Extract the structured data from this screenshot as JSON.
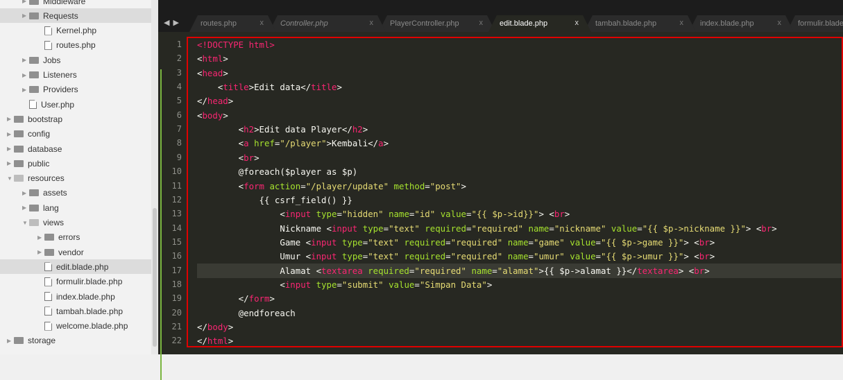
{
  "sidebar": {
    "rows": [
      {
        "label": "Middleware",
        "type": "folder",
        "depth": 2,
        "open": false
      },
      {
        "label": "Requests",
        "type": "folder",
        "depth": 2,
        "open": false,
        "selected": true
      },
      {
        "label": "Kernel.php",
        "type": "file",
        "depth": 3
      },
      {
        "label": "routes.php",
        "type": "file",
        "depth": 3
      },
      {
        "label": "Jobs",
        "type": "folder",
        "depth": 2,
        "open": false
      },
      {
        "label": "Listeners",
        "type": "folder",
        "depth": 2,
        "open": false
      },
      {
        "label": "Providers",
        "type": "folder",
        "depth": 2,
        "open": false
      },
      {
        "label": "User.php",
        "type": "file",
        "depth": 2
      },
      {
        "label": "bootstrap",
        "type": "folder",
        "depth": 1,
        "open": false
      },
      {
        "label": "config",
        "type": "folder",
        "depth": 1,
        "open": false
      },
      {
        "label": "database",
        "type": "folder",
        "depth": 1,
        "open": false
      },
      {
        "label": "public",
        "type": "folder",
        "depth": 1,
        "open": false
      },
      {
        "label": "resources",
        "type": "folder",
        "depth": 1,
        "open": true
      },
      {
        "label": "assets",
        "type": "folder",
        "depth": 2,
        "open": false
      },
      {
        "label": "lang",
        "type": "folder",
        "depth": 2,
        "open": false
      },
      {
        "label": "views",
        "type": "folder",
        "depth": 2,
        "open": true
      },
      {
        "label": "errors",
        "type": "folder",
        "depth": 3,
        "open": false
      },
      {
        "label": "vendor",
        "type": "folder",
        "depth": 3,
        "open": false
      },
      {
        "label": "edit.blade.php",
        "type": "file",
        "depth": 3,
        "selected": true
      },
      {
        "label": "formulir.blade.php",
        "type": "file",
        "depth": 3
      },
      {
        "label": "index.blade.php",
        "type": "file",
        "depth": 3
      },
      {
        "label": "tambah.blade.php",
        "type": "file",
        "depth": 3
      },
      {
        "label": "welcome.blade.php",
        "type": "file",
        "depth": 3
      },
      {
        "label": "storage",
        "type": "folder",
        "depth": 1,
        "open": false
      }
    ]
  },
  "tabs": [
    {
      "label": "routes.php",
      "italic": false,
      "active": false,
      "close": "x"
    },
    {
      "label": "Controller.php",
      "italic": true,
      "active": false,
      "close": "x"
    },
    {
      "label": "PlayerController.php",
      "italic": false,
      "active": false,
      "close": "x"
    },
    {
      "label": "edit.blade.php",
      "italic": false,
      "active": true,
      "close": "x"
    },
    {
      "label": "tambah.blade.php",
      "italic": false,
      "active": false,
      "close": "x"
    },
    {
      "label": "index.blade.php",
      "italic": false,
      "active": false,
      "close": "x"
    },
    {
      "label": "formulir.blade",
      "italic": false,
      "active": false,
      "close": ""
    }
  ],
  "tab_nav": "◀ ▶",
  "current_line": 17,
  "code_lines": [
    [
      [
        "tg",
        "<!DOCTYPE html>"
      ]
    ],
    [
      [
        "tx",
        "<"
      ],
      [
        "tg",
        "html"
      ],
      [
        "tx",
        ">"
      ]
    ],
    [
      [
        "tx",
        "<"
      ],
      [
        "tg",
        "head"
      ],
      [
        "tx",
        ">"
      ]
    ],
    [
      [
        "tx",
        "    <"
      ],
      [
        "tg",
        "title"
      ],
      [
        "tx",
        ">Edit data</"
      ],
      [
        "tg",
        "title"
      ],
      [
        "tx",
        ">"
      ]
    ],
    [
      [
        "tx",
        "</"
      ],
      [
        "tg",
        "head"
      ],
      [
        "tx",
        ">"
      ]
    ],
    [
      [
        "tx",
        "<"
      ],
      [
        "tg",
        "body"
      ],
      [
        "tx",
        ">"
      ]
    ],
    [
      [
        "tx",
        "        <"
      ],
      [
        "tg",
        "h2"
      ],
      [
        "tx",
        ">Edit data Player</"
      ],
      [
        "tg",
        "h2"
      ],
      [
        "tx",
        ">"
      ]
    ],
    [
      [
        "tx",
        "        <"
      ],
      [
        "tg",
        "a"
      ],
      [
        "tx",
        " "
      ],
      [
        "at",
        "href"
      ],
      [
        "tx",
        "="
      ],
      [
        "st",
        "\"/player\""
      ],
      [
        "tx",
        ">Kembali</"
      ],
      [
        "tg",
        "a"
      ],
      [
        "tx",
        ">"
      ]
    ],
    [
      [
        "tx",
        "        <"
      ],
      [
        "tg",
        "br"
      ],
      [
        "tx",
        ">"
      ]
    ],
    [
      [
        "tx",
        "        @foreach($player as $p)"
      ]
    ],
    [
      [
        "tx",
        "        <"
      ],
      [
        "tg",
        "form"
      ],
      [
        "tx",
        " "
      ],
      [
        "at",
        "action"
      ],
      [
        "tx",
        "="
      ],
      [
        "st",
        "\"/player/update\""
      ],
      [
        "tx",
        " "
      ],
      [
        "at",
        "method"
      ],
      [
        "tx",
        "="
      ],
      [
        "st",
        "\"post\""
      ],
      [
        "tx",
        ">"
      ]
    ],
    [
      [
        "tx",
        "            {{ csrf_field() }}"
      ]
    ],
    [
      [
        "tx",
        "                <"
      ],
      [
        "tg",
        "input"
      ],
      [
        "tx",
        " "
      ],
      [
        "at",
        "type"
      ],
      [
        "tx",
        "="
      ],
      [
        "st",
        "\"hidden\""
      ],
      [
        "tx",
        " "
      ],
      [
        "at",
        "name"
      ],
      [
        "tx",
        "="
      ],
      [
        "st",
        "\"id\""
      ],
      [
        "tx",
        " "
      ],
      [
        "at",
        "value"
      ],
      [
        "tx",
        "="
      ],
      [
        "st",
        "\"{{ $p->id}}\""
      ],
      [
        "tx",
        "> <"
      ],
      [
        "tg",
        "br"
      ],
      [
        "tx",
        ">"
      ]
    ],
    [
      [
        "tx",
        "                Nickname <"
      ],
      [
        "tg",
        "input"
      ],
      [
        "tx",
        " "
      ],
      [
        "at",
        "type"
      ],
      [
        "tx",
        "="
      ],
      [
        "st",
        "\"text\""
      ],
      [
        "tx",
        " "
      ],
      [
        "at",
        "required"
      ],
      [
        "tx",
        "="
      ],
      [
        "st",
        "\"required\""
      ],
      [
        "tx",
        " "
      ],
      [
        "at",
        "name"
      ],
      [
        "tx",
        "="
      ],
      [
        "st",
        "\"nickname\""
      ],
      [
        "tx",
        " "
      ],
      [
        "at",
        "value"
      ],
      [
        "tx",
        "="
      ],
      [
        "st",
        "\"{{ $p->nickname }}\""
      ],
      [
        "tx",
        "> <"
      ],
      [
        "tg",
        "br"
      ],
      [
        "tx",
        ">"
      ]
    ],
    [
      [
        "tx",
        "                Game <"
      ],
      [
        "tg",
        "input"
      ],
      [
        "tx",
        " "
      ],
      [
        "at",
        "type"
      ],
      [
        "tx",
        "="
      ],
      [
        "st",
        "\"text\""
      ],
      [
        "tx",
        " "
      ],
      [
        "at",
        "required"
      ],
      [
        "tx",
        "="
      ],
      [
        "st",
        "\"required\""
      ],
      [
        "tx",
        " "
      ],
      [
        "at",
        "name"
      ],
      [
        "tx",
        "="
      ],
      [
        "st",
        "\"game\""
      ],
      [
        "tx",
        " "
      ],
      [
        "at",
        "value"
      ],
      [
        "tx",
        "="
      ],
      [
        "st",
        "\"{{ $p->game }}\""
      ],
      [
        "tx",
        "> <"
      ],
      [
        "tg",
        "br"
      ],
      [
        "tx",
        ">"
      ]
    ],
    [
      [
        "tx",
        "                Umur <"
      ],
      [
        "tg",
        "input"
      ],
      [
        "tx",
        " "
      ],
      [
        "at",
        "type"
      ],
      [
        "tx",
        "="
      ],
      [
        "st",
        "\"text\""
      ],
      [
        "tx",
        " "
      ],
      [
        "at",
        "required"
      ],
      [
        "tx",
        "="
      ],
      [
        "st",
        "\"required\""
      ],
      [
        "tx",
        " "
      ],
      [
        "at",
        "name"
      ],
      [
        "tx",
        "="
      ],
      [
        "st",
        "\"umur\""
      ],
      [
        "tx",
        " "
      ],
      [
        "at",
        "value"
      ],
      [
        "tx",
        "="
      ],
      [
        "st",
        "\"{{ $p->umur }}\""
      ],
      [
        "tx",
        "> <"
      ],
      [
        "tg",
        "br"
      ],
      [
        "tx",
        ">"
      ]
    ],
    [
      [
        "tx",
        "                Alamat <"
      ],
      [
        "tg",
        "textarea"
      ],
      [
        "tx",
        " "
      ],
      [
        "at",
        "required"
      ],
      [
        "tx",
        "="
      ],
      [
        "st",
        "\"required\""
      ],
      [
        "tx",
        " "
      ],
      [
        "at",
        "name"
      ],
      [
        "tx",
        "="
      ],
      [
        "st",
        "\"alamat\""
      ],
      [
        "tx",
        ">{{ $p->alamat }}</"
      ],
      [
        "tg",
        "textarea"
      ],
      [
        "tx",
        "> <"
      ],
      [
        "tg",
        "br"
      ],
      [
        "tx",
        ">"
      ]
    ],
    [
      [
        "tx",
        "                <"
      ],
      [
        "tg",
        "input"
      ],
      [
        "tx",
        " "
      ],
      [
        "at",
        "type"
      ],
      [
        "tx",
        "="
      ],
      [
        "st",
        "\"submit\""
      ],
      [
        "tx",
        " "
      ],
      [
        "at",
        "value"
      ],
      [
        "tx",
        "="
      ],
      [
        "st",
        "\"Simpan Data\""
      ],
      [
        "tx",
        ">"
      ]
    ],
    [
      [
        "tx",
        "        </"
      ],
      [
        "tg",
        "form"
      ],
      [
        "tx",
        ">"
      ]
    ],
    [
      [
        "tx",
        "        @endforeach"
      ]
    ],
    [
      [
        "tx",
        "</"
      ],
      [
        "tg",
        "body"
      ],
      [
        "tx",
        ">"
      ]
    ],
    [
      [
        "tx",
        "</"
      ],
      [
        "tg",
        "html"
      ],
      [
        "tx",
        ">"
      ]
    ]
  ]
}
